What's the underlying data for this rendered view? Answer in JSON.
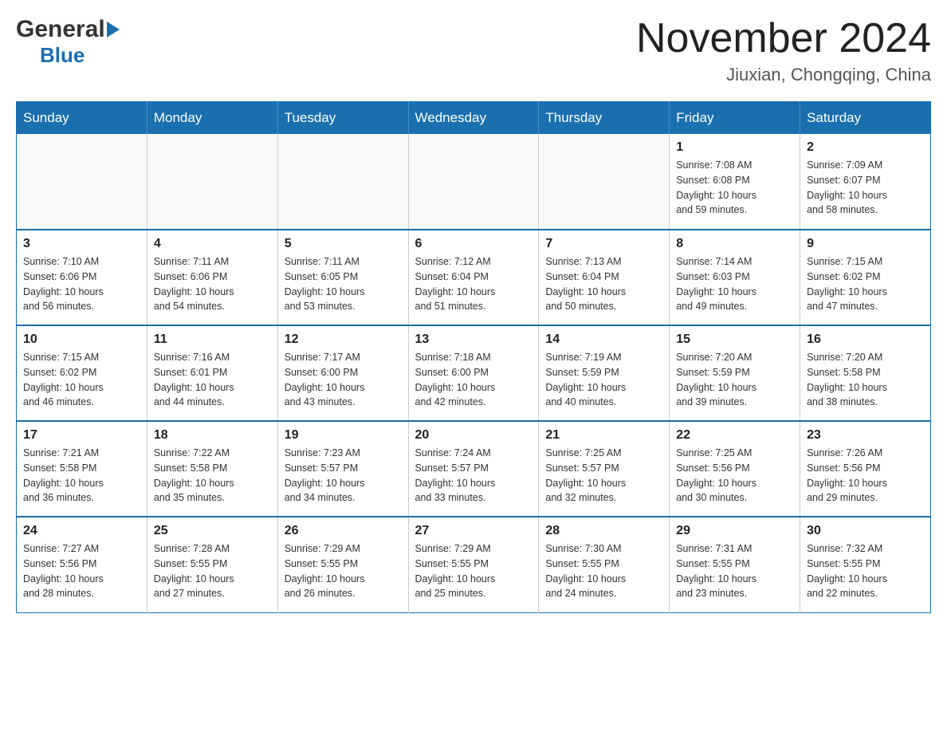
{
  "header": {
    "logo_general": "General",
    "logo_blue": "Blue",
    "month_title": "November 2024",
    "location": "Jiuxian, Chongqing, China"
  },
  "days_of_week": [
    "Sunday",
    "Monday",
    "Tuesday",
    "Wednesday",
    "Thursday",
    "Friday",
    "Saturday"
  ],
  "weeks": [
    [
      {
        "day": "",
        "info": ""
      },
      {
        "day": "",
        "info": ""
      },
      {
        "day": "",
        "info": ""
      },
      {
        "day": "",
        "info": ""
      },
      {
        "day": "",
        "info": ""
      },
      {
        "day": "1",
        "info": "Sunrise: 7:08 AM\nSunset: 6:08 PM\nDaylight: 10 hours\nand 59 minutes."
      },
      {
        "day": "2",
        "info": "Sunrise: 7:09 AM\nSunset: 6:07 PM\nDaylight: 10 hours\nand 58 minutes."
      }
    ],
    [
      {
        "day": "3",
        "info": "Sunrise: 7:10 AM\nSunset: 6:06 PM\nDaylight: 10 hours\nand 56 minutes."
      },
      {
        "day": "4",
        "info": "Sunrise: 7:11 AM\nSunset: 6:06 PM\nDaylight: 10 hours\nand 54 minutes."
      },
      {
        "day": "5",
        "info": "Sunrise: 7:11 AM\nSunset: 6:05 PM\nDaylight: 10 hours\nand 53 minutes."
      },
      {
        "day": "6",
        "info": "Sunrise: 7:12 AM\nSunset: 6:04 PM\nDaylight: 10 hours\nand 51 minutes."
      },
      {
        "day": "7",
        "info": "Sunrise: 7:13 AM\nSunset: 6:04 PM\nDaylight: 10 hours\nand 50 minutes."
      },
      {
        "day": "8",
        "info": "Sunrise: 7:14 AM\nSunset: 6:03 PM\nDaylight: 10 hours\nand 49 minutes."
      },
      {
        "day": "9",
        "info": "Sunrise: 7:15 AM\nSunset: 6:02 PM\nDaylight: 10 hours\nand 47 minutes."
      }
    ],
    [
      {
        "day": "10",
        "info": "Sunrise: 7:15 AM\nSunset: 6:02 PM\nDaylight: 10 hours\nand 46 minutes."
      },
      {
        "day": "11",
        "info": "Sunrise: 7:16 AM\nSunset: 6:01 PM\nDaylight: 10 hours\nand 44 minutes."
      },
      {
        "day": "12",
        "info": "Sunrise: 7:17 AM\nSunset: 6:00 PM\nDaylight: 10 hours\nand 43 minutes."
      },
      {
        "day": "13",
        "info": "Sunrise: 7:18 AM\nSunset: 6:00 PM\nDaylight: 10 hours\nand 42 minutes."
      },
      {
        "day": "14",
        "info": "Sunrise: 7:19 AM\nSunset: 5:59 PM\nDaylight: 10 hours\nand 40 minutes."
      },
      {
        "day": "15",
        "info": "Sunrise: 7:20 AM\nSunset: 5:59 PM\nDaylight: 10 hours\nand 39 minutes."
      },
      {
        "day": "16",
        "info": "Sunrise: 7:20 AM\nSunset: 5:58 PM\nDaylight: 10 hours\nand 38 minutes."
      }
    ],
    [
      {
        "day": "17",
        "info": "Sunrise: 7:21 AM\nSunset: 5:58 PM\nDaylight: 10 hours\nand 36 minutes."
      },
      {
        "day": "18",
        "info": "Sunrise: 7:22 AM\nSunset: 5:58 PM\nDaylight: 10 hours\nand 35 minutes."
      },
      {
        "day": "19",
        "info": "Sunrise: 7:23 AM\nSunset: 5:57 PM\nDaylight: 10 hours\nand 34 minutes."
      },
      {
        "day": "20",
        "info": "Sunrise: 7:24 AM\nSunset: 5:57 PM\nDaylight: 10 hours\nand 33 minutes."
      },
      {
        "day": "21",
        "info": "Sunrise: 7:25 AM\nSunset: 5:57 PM\nDaylight: 10 hours\nand 32 minutes."
      },
      {
        "day": "22",
        "info": "Sunrise: 7:25 AM\nSunset: 5:56 PM\nDaylight: 10 hours\nand 30 minutes."
      },
      {
        "day": "23",
        "info": "Sunrise: 7:26 AM\nSunset: 5:56 PM\nDaylight: 10 hours\nand 29 minutes."
      }
    ],
    [
      {
        "day": "24",
        "info": "Sunrise: 7:27 AM\nSunset: 5:56 PM\nDaylight: 10 hours\nand 28 minutes."
      },
      {
        "day": "25",
        "info": "Sunrise: 7:28 AM\nSunset: 5:55 PM\nDaylight: 10 hours\nand 27 minutes."
      },
      {
        "day": "26",
        "info": "Sunrise: 7:29 AM\nSunset: 5:55 PM\nDaylight: 10 hours\nand 26 minutes."
      },
      {
        "day": "27",
        "info": "Sunrise: 7:29 AM\nSunset: 5:55 PM\nDaylight: 10 hours\nand 25 minutes."
      },
      {
        "day": "28",
        "info": "Sunrise: 7:30 AM\nSunset: 5:55 PM\nDaylight: 10 hours\nand 24 minutes."
      },
      {
        "day": "29",
        "info": "Sunrise: 7:31 AM\nSunset: 5:55 PM\nDaylight: 10 hours\nand 23 minutes."
      },
      {
        "day": "30",
        "info": "Sunrise: 7:32 AM\nSunset: 5:55 PM\nDaylight: 10 hours\nand 22 minutes."
      }
    ]
  ]
}
